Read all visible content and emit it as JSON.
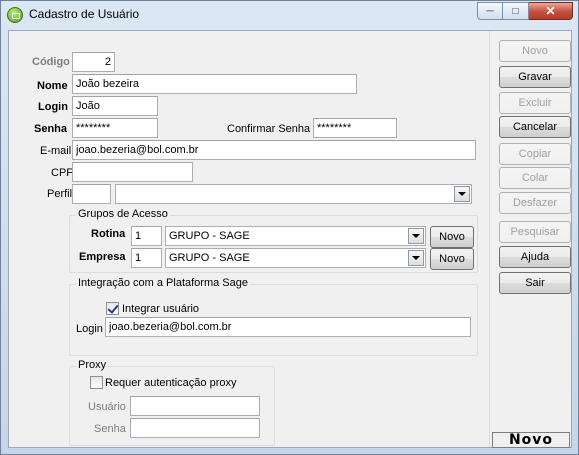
{
  "window": {
    "title": "Cadastro de Usuário",
    "icon": "app-icon",
    "caption_buttons": {
      "minimize": "─",
      "maximize": "□",
      "close": "✕"
    }
  },
  "form": {
    "codigo": {
      "label": "Código",
      "value": "2"
    },
    "nome": {
      "label": "Nome",
      "value": "João bezeira"
    },
    "login": {
      "label": "Login",
      "value": "João"
    },
    "senha": {
      "label": "Senha",
      "value": "********"
    },
    "confirmar_senha": {
      "label": "Confirmar Senha",
      "value": "********"
    },
    "email": {
      "label": "E-mail",
      "value": "joao.bezeria@bol.com.br"
    },
    "cpf": {
      "label": "CPF",
      "value": ""
    },
    "perfil": {
      "label": "Perfil",
      "code": "",
      "selected": ""
    },
    "grupos_acesso": {
      "title": "Grupos de Acesso",
      "rotina": {
        "label": "Rotina",
        "code": "1",
        "selected": "GRUPO - SAGE",
        "button": "Novo"
      },
      "empresa": {
        "label": "Empresa",
        "code": "1",
        "selected": "GRUPO - SAGE",
        "button": "Novo"
      }
    },
    "integracao": {
      "title": "Integração com a Plataforma Sage",
      "checkbox_label": "Integrar usuário",
      "checked": true,
      "login_label": "Login",
      "login_value": "joao.bezeria@bol.com.br"
    },
    "proxy": {
      "title": "Proxy",
      "checkbox_label": "Requer autenticação proxy",
      "checked": false,
      "usuario_label": "Usuário",
      "usuario_value": "",
      "senha_label": "Senha",
      "senha_value": ""
    }
  },
  "sidebar": {
    "buttons": [
      {
        "label": "Novo",
        "enabled": false
      },
      {
        "label": "Gravar",
        "enabled": true
      },
      {
        "label": "Excluir",
        "enabled": false
      },
      {
        "label": "Cancelar",
        "enabled": true
      },
      {
        "label": "Copiar",
        "enabled": false
      },
      {
        "label": "Colar",
        "enabled": false
      },
      {
        "label": "Desfazer",
        "enabled": false
      },
      {
        "label": "Pesquisar",
        "enabled": false
      },
      {
        "label": "Ajuda",
        "enabled": true
      },
      {
        "label": "Sair",
        "enabled": true
      }
    ],
    "status": "Novo"
  }
}
